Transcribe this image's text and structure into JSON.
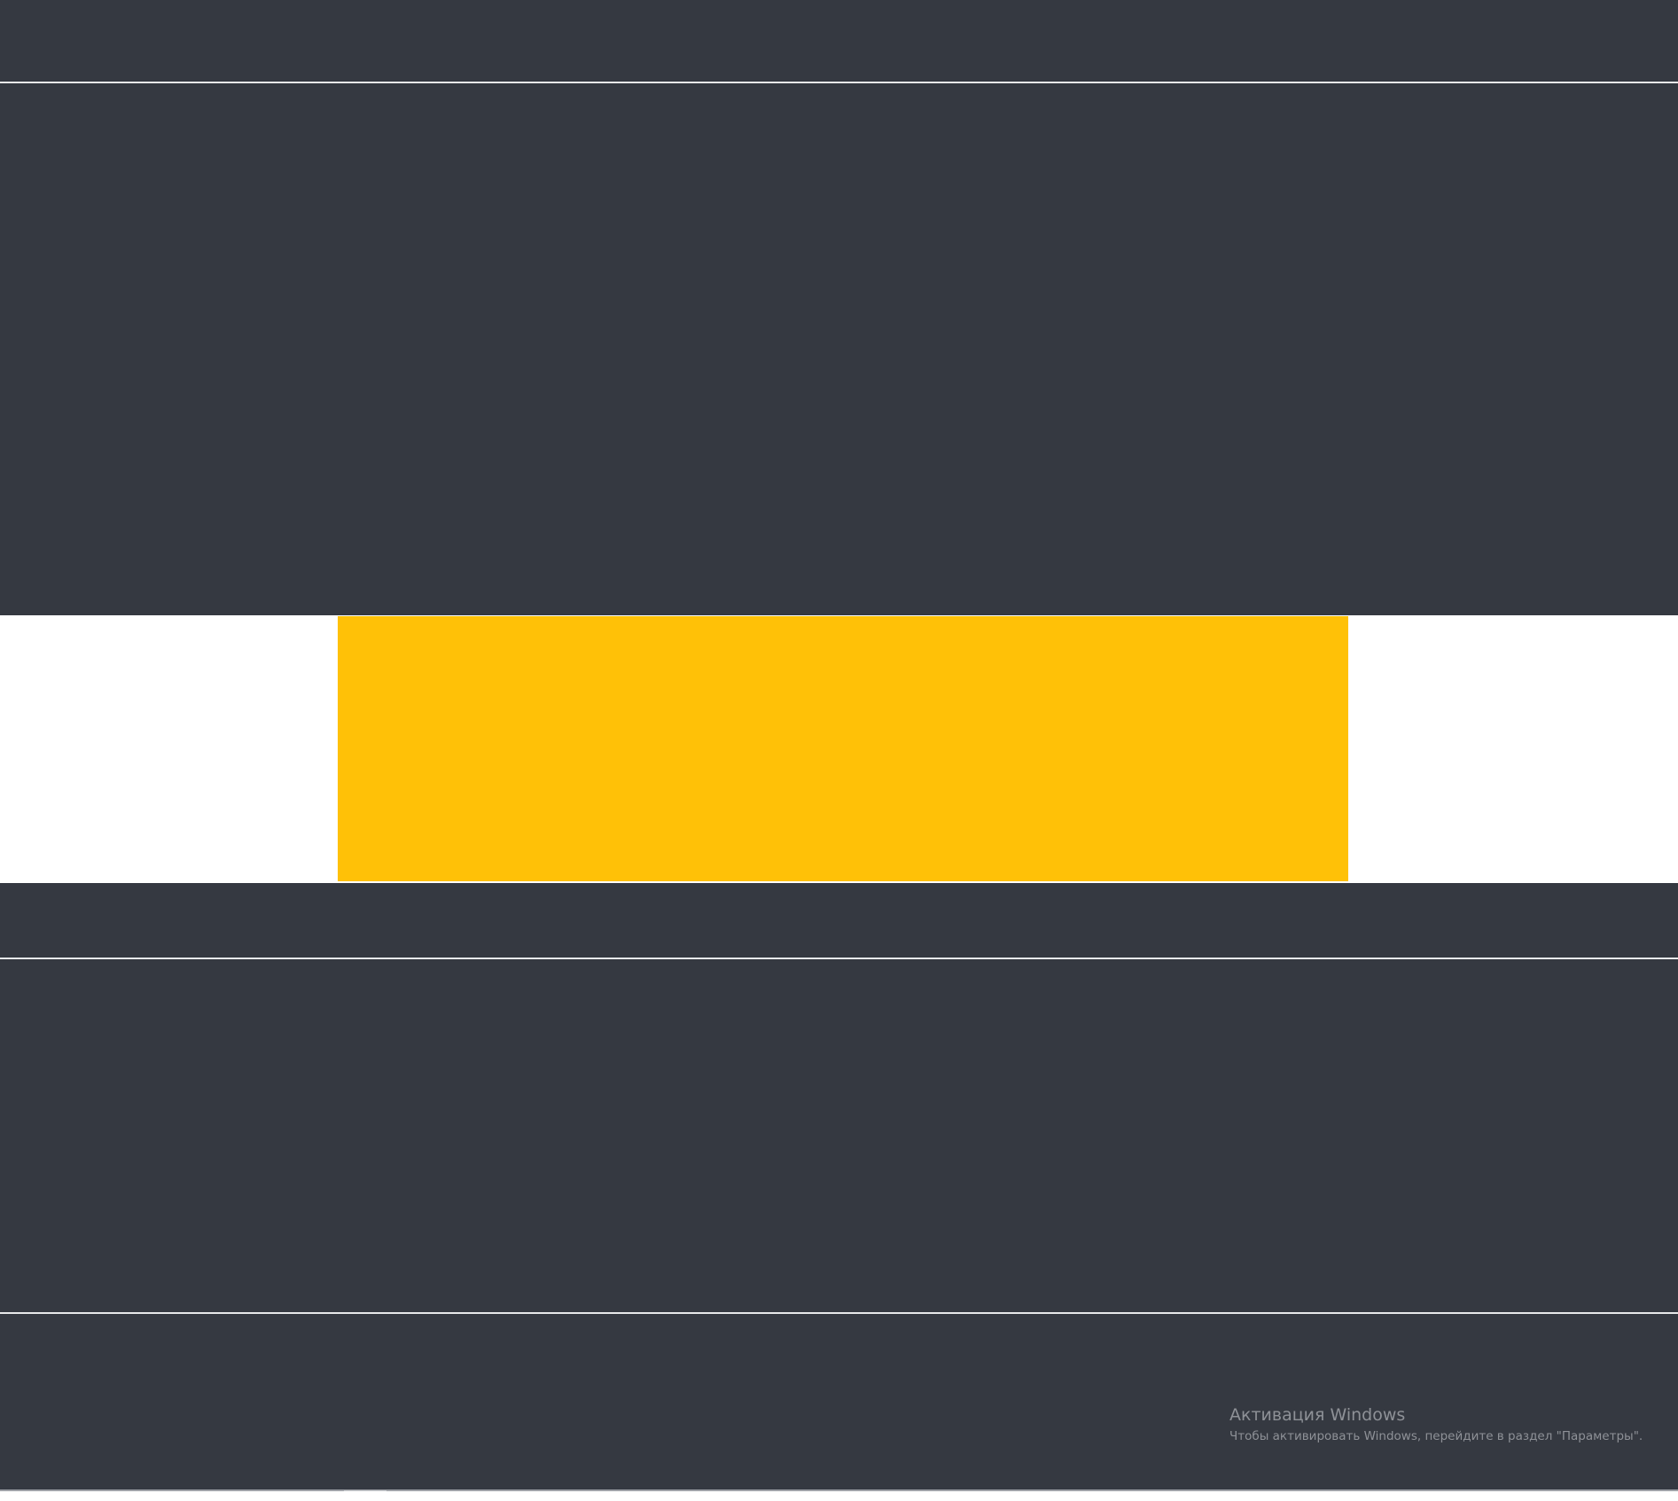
{
  "colors": {
    "background": "#353941",
    "divider": "#e8e9ea",
    "white_strip": "#ffffff",
    "accent_block": "#ffc107",
    "watermark_text": "#8e9197"
  },
  "watermark": {
    "title": "Активация Windows",
    "subtitle": "Чтобы активировать Windows, перейдите в раздел \"Параметры\"."
  }
}
